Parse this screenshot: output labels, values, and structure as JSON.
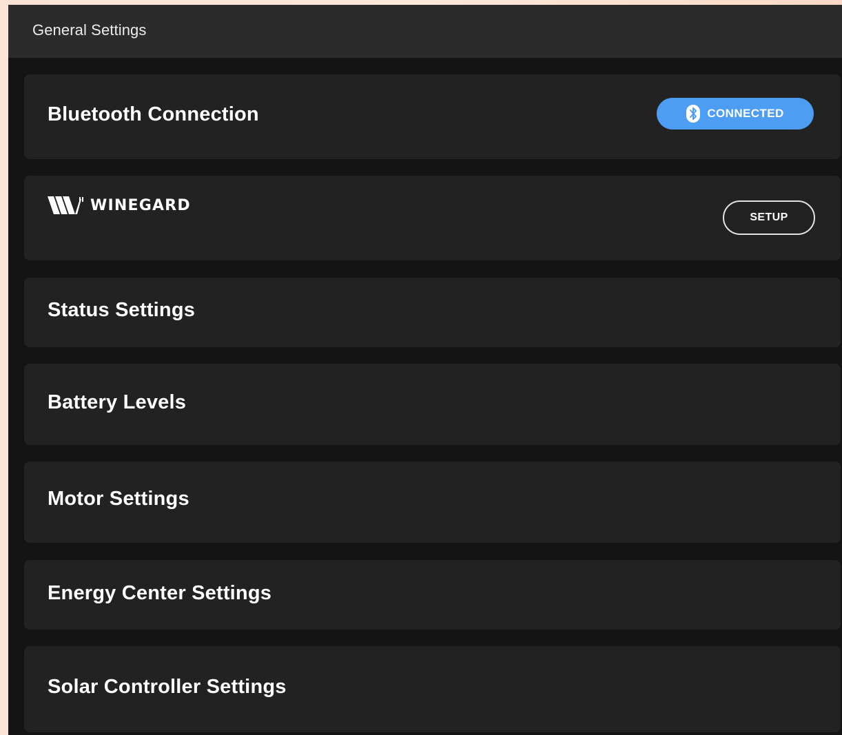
{
  "header": {
    "title": "General Settings"
  },
  "cards": {
    "bluetooth": {
      "title": "Bluetooth Connection",
      "status_label": "CONNECTED",
      "status_color": "#4d9df2"
    },
    "winegard": {
      "brand": "WINEGARD",
      "setup_label": "SETUP"
    },
    "status_settings": {
      "title": "Status Settings"
    },
    "battery_levels": {
      "title": "Battery Levels"
    },
    "motor_settings": {
      "title": "Motor Settings"
    },
    "energy_center_settings": {
      "title": "Energy Center Settings"
    },
    "solar_controller_settings": {
      "title": "Solar Controller Settings"
    }
  },
  "icons": {
    "bluetooth": "bluetooth-icon",
    "brand_logo": "winegard-logo"
  },
  "theme": {
    "background": "#141414",
    "card": "#222222",
    "header": "#2b2b2b",
    "text": "#ffffff"
  }
}
